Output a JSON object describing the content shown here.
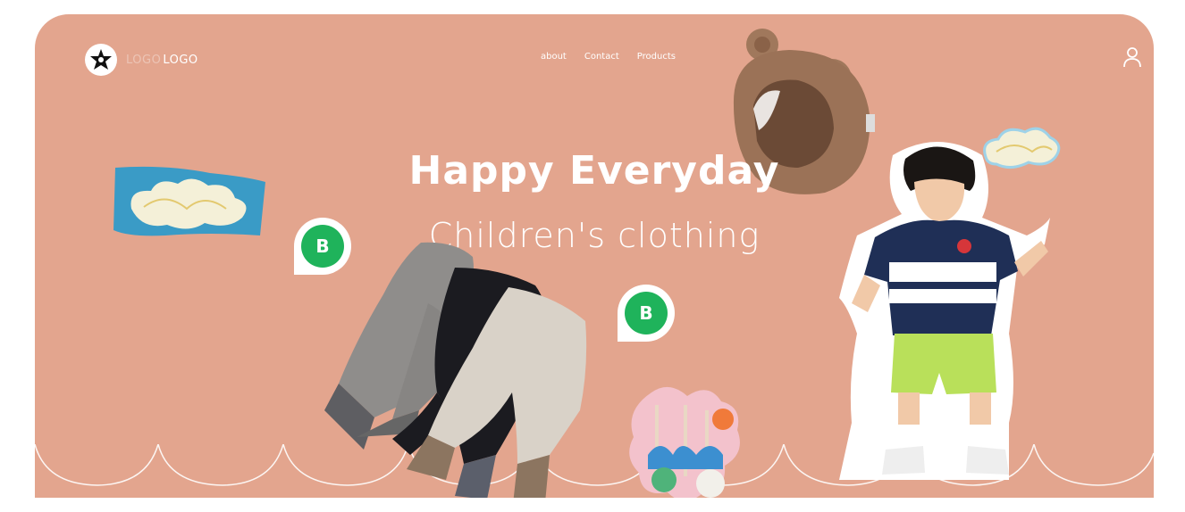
{
  "brand": {
    "logo_ghost": "LOGO",
    "logo_text": "LOGO"
  },
  "nav": {
    "items": [
      "about",
      "Contact",
      "Products"
    ]
  },
  "hero": {
    "headline": "Happy Everyday",
    "subheadline": "Children's clothing"
  },
  "badges": [
    {
      "label": "B"
    },
    {
      "label": "B"
    }
  ],
  "colors": {
    "hero_bg": "#e3a58e",
    "badge_green": "#1fb35b",
    "cloud_blue": "#3a9bc6"
  },
  "icons": {
    "user": "user-icon",
    "menu": "menu-icon",
    "logo": "star-logo-icon"
  }
}
